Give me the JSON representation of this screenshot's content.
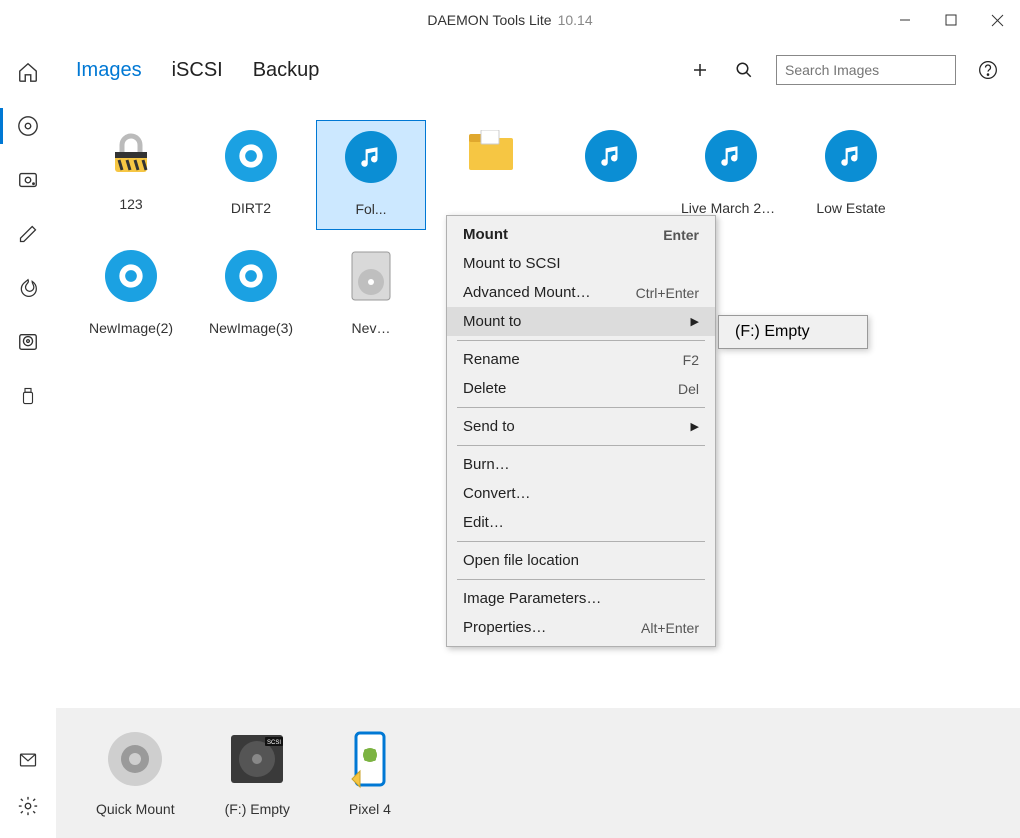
{
  "title": {
    "app": "DAEMON Tools Lite",
    "version": "10.14"
  },
  "tabs": {
    "images": "Images",
    "iscsi": "iSCSI",
    "backup": "Backup"
  },
  "search": {
    "placeholder": "Search Images"
  },
  "sidebar": {
    "home": "home",
    "disc": "disc",
    "drive": "drive",
    "edit": "edit",
    "burn": "burn",
    "hdd": "hdd",
    "usb": "usb",
    "news": "news",
    "settings": "settings"
  },
  "items": [
    {
      "label": "123",
      "icon": "lock"
    },
    {
      "label": "DIRT2",
      "icon": "target"
    },
    {
      "label": "Fol...",
      "icon": "music",
      "selected": true
    },
    {
      "label": "",
      "icon": "folder"
    },
    {
      "label": "",
      "icon": "music"
    },
    {
      "label": "Live March 20…",
      "icon": "music"
    },
    {
      "label": "Low Estate",
      "icon": "music"
    },
    {
      "label": "NewImage(2)",
      "icon": "target"
    },
    {
      "label": "NewImage(3)",
      "icon": "target"
    },
    {
      "label": "Nev…",
      "icon": "iso"
    },
    {
      "label": "…",
      "icon": "blank"
    }
  ],
  "menu": {
    "mount": {
      "label": "Mount",
      "shortcut": "Enter"
    },
    "mount_scsi": {
      "label": "Mount to SCSI"
    },
    "adv_mount": {
      "label": "Advanced Mount…",
      "shortcut": "Ctrl+Enter"
    },
    "mount_to": {
      "label": "Mount to"
    },
    "rename": {
      "label": "Rename",
      "shortcut": "F2"
    },
    "delete": {
      "label": "Delete",
      "shortcut": "Del"
    },
    "send_to": {
      "label": "Send to"
    },
    "burn": {
      "label": "Burn…"
    },
    "convert": {
      "label": "Convert…"
    },
    "edit": {
      "label": "Edit…"
    },
    "open_loc": {
      "label": "Open file location"
    },
    "img_params": {
      "label": "Image Parameters…"
    },
    "properties": {
      "label": "Properties…",
      "shortcut": "Alt+Enter"
    }
  },
  "submenu": {
    "f_empty": "(F:) Empty"
  },
  "drives": {
    "quick_mount": "Quick Mount",
    "f_empty": "(F:) Empty",
    "pixel4": "Pixel 4"
  }
}
